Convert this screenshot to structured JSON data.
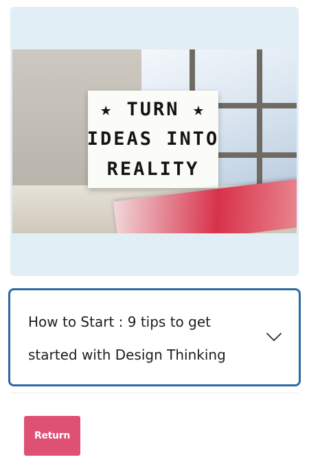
{
  "hero": {
    "image_alt": "Lightbox sign on a window sill",
    "lightbox_lines": [
      "★ TURN ★",
      "IDEAS INTO",
      "REALITY"
    ]
  },
  "accordion": {
    "title": "How to Start : 9 tips to get started with Design Thinking",
    "toggle_icon": "chevron-down-icon",
    "border_color": "#2a69a3"
  },
  "actions": {
    "return_label": "Return",
    "return_color": "#de5074"
  },
  "colors": {
    "card_background": "#e1eef6"
  }
}
